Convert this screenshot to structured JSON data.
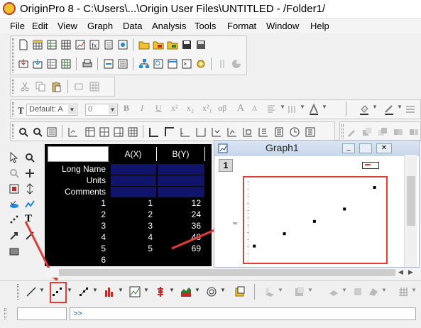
{
  "window": {
    "title": "OriginPro 8 - C:\\Users\\...\\Origin User Files\\UNTITLED - /Folder1/"
  },
  "menu": [
    "File",
    "Edit",
    "View",
    "Graph",
    "Data",
    "Analysis",
    "Tools",
    "Format",
    "Window",
    "Help"
  ],
  "format_toolbar": {
    "font_value": "Default: A",
    "size_value": "0",
    "bold_label": "B",
    "italic_label": "I",
    "underline_label": "U",
    "superscript_label": "x²",
    "subscript_label": "x₂",
    "supsub_label": "x²₁",
    "greek_label": "αβ",
    "bigger_label": "A",
    "smaller_label": "A"
  },
  "tools_panel": {
    "text_tool_label": "T"
  },
  "worksheet": {
    "columns": [
      "A(X)",
      "B(Y)"
    ],
    "label_rows": [
      "Long Name",
      "Units",
      "Comments"
    ],
    "rows": [
      {
        "index": "1",
        "a": "1",
        "b": "12"
      },
      {
        "index": "2",
        "a": "2",
        "b": "24"
      },
      {
        "index": "3",
        "a": "3",
        "b": "36"
      },
      {
        "index": "4",
        "a": "4",
        "b": "48"
      },
      {
        "index": "5",
        "a": "5",
        "b": "69"
      },
      {
        "index": "6",
        "a": "",
        "b": ""
      }
    ]
  },
  "graph_window": {
    "title": "Graph1",
    "layer_label": "1"
  },
  "command_window": {
    "prompt": ">>"
  },
  "colors": {
    "highlight": "#e53935",
    "sheet_header_bg": "#000000",
    "sheet_label_bg": "#10156b",
    "graph_titlebar": "#c6d6ea"
  },
  "chart_data": {
    "type": "scatter",
    "x": [
      1,
      2,
      3,
      4,
      5
    ],
    "y": [
      12,
      24,
      36,
      48,
      69
    ]
  }
}
